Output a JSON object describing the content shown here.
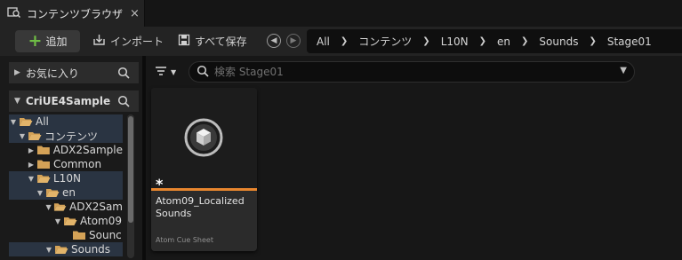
{
  "tab": {
    "title": "コンテンツブラウザ",
    "close": "×"
  },
  "toolbar": {
    "add_label": "追加",
    "import_label": "インポート",
    "save_all_label": "すべて保存"
  },
  "breadcrumb": [
    "All",
    "コンテンツ",
    "L10N",
    "en",
    "Sounds",
    "Stage01"
  ],
  "sidebar": {
    "favorites_label": "お気に入り",
    "project_label": "CriUE4Sample",
    "tree": [
      {
        "label": "All",
        "depth": 0,
        "expanded": true,
        "selected": true
      },
      {
        "label": "コンテンツ",
        "depth": 1,
        "expanded": true,
        "selected": true
      },
      {
        "label": "ADX2Sample",
        "depth": 2,
        "expanded": false,
        "selected": false
      },
      {
        "label": "Common",
        "depth": 2,
        "expanded": false,
        "selected": false
      },
      {
        "label": "L10N",
        "depth": 2,
        "expanded": true,
        "selected": true
      },
      {
        "label": "en",
        "depth": 3,
        "expanded": true,
        "selected": true
      },
      {
        "label": "ADX2Sam",
        "depth": 4,
        "expanded": true,
        "selected": false
      },
      {
        "label": "Atom09",
        "depth": 5,
        "expanded": true,
        "selected": false
      },
      {
        "label": "Sounc",
        "depth": 6,
        "expanded": null,
        "selected": false
      },
      {
        "label": "Sounds",
        "depth": 4,
        "expanded": true,
        "selected": true
      }
    ]
  },
  "search": {
    "placeholder": "検索 Stage01",
    "value": ""
  },
  "asset": {
    "name": "Atom09_Localized Sounds",
    "type": "Atom Cue Sheet",
    "dirty_marker": "*"
  },
  "colors": {
    "accent_orange": "#e8862e",
    "add_green": "#6fbd45",
    "folder": "#d4a257",
    "selection": "#2a3442"
  }
}
